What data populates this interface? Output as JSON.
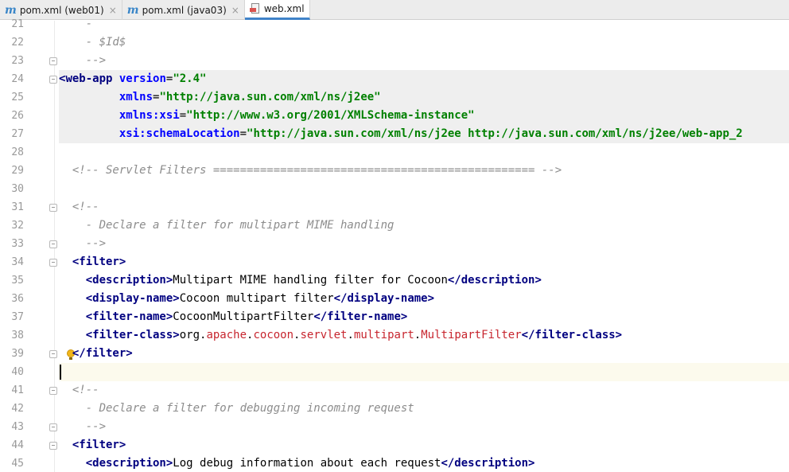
{
  "tabs": [
    {
      "label": "pom.xml (web01)",
      "icon": "maven-icon",
      "active": false
    },
    {
      "label": "pom.xml (java03)",
      "icon": "maven-icon",
      "active": false
    },
    {
      "label": "web.xml",
      "icon": "xml-file-icon",
      "active": true
    }
  ],
  "icons": {
    "maven_glyph": "m",
    "close_glyph": "×"
  },
  "colors": {
    "tag": "#000080",
    "attribute": "#0000ff",
    "value": "#008000",
    "comment": "#8c8c8c",
    "package": "#c7252e",
    "active_tab_underline": "#4083c9"
  },
  "editor": {
    "lines": [
      {
        "num": "21",
        "fold": false,
        "tokens": [
          {
            "t": "    -",
            "c": "c-comment"
          }
        ]
      },
      {
        "num": "22",
        "fold": false,
        "tokens": [
          {
            "t": "    - $Id$",
            "c": "c-comment"
          }
        ]
      },
      {
        "num": "23",
        "fold": true,
        "tokens": [
          {
            "t": "    -->",
            "c": "c-comment"
          }
        ]
      },
      {
        "num": "24",
        "fold": true,
        "hl": true,
        "tokens": [
          {
            "t": "<",
            "c": "c-tag"
          },
          {
            "t": "web-app ",
            "c": "c-tag"
          },
          {
            "t": "version",
            "c": "c-attr"
          },
          {
            "t": "=",
            "c": "c-br"
          },
          {
            "t": "\"2.4\"",
            "c": "c-val"
          }
        ]
      },
      {
        "num": "25",
        "fold": false,
        "hl": true,
        "tokens": [
          {
            "t": "         xmlns",
            "c": "c-attr"
          },
          {
            "t": "=",
            "c": "c-br"
          },
          {
            "t": "\"http://java.sun.com/xml/ns/j2ee\"",
            "c": "c-val"
          }
        ]
      },
      {
        "num": "26",
        "fold": false,
        "hl": true,
        "tokens": [
          {
            "t": "         xmlns:xsi",
            "c": "c-attr"
          },
          {
            "t": "=",
            "c": "c-br"
          },
          {
            "t": "\"http://www.w3.org/2001/XMLSchema-instance\"",
            "c": "c-val"
          }
        ]
      },
      {
        "num": "27",
        "fold": false,
        "hl": true,
        "tokens": [
          {
            "t": "         xsi:schemaLocation",
            "c": "c-attr"
          },
          {
            "t": "=",
            "c": "c-br"
          },
          {
            "t": "\"http://java.sun.com/xml/ns/j2ee http://java.sun.com/xml/ns/j2ee/web-app_2",
            "c": "c-val"
          }
        ]
      },
      {
        "num": "28",
        "fold": false,
        "tokens": []
      },
      {
        "num": "29",
        "fold": false,
        "tokens": [
          {
            "t": "  <!-- Servlet Filters ================================================ -->",
            "c": "c-comment"
          }
        ]
      },
      {
        "num": "30",
        "fold": false,
        "tokens": []
      },
      {
        "num": "31",
        "fold": true,
        "tokens": [
          {
            "t": "  <!--",
            "c": "c-comment"
          }
        ]
      },
      {
        "num": "32",
        "fold": false,
        "tokens": [
          {
            "t": "    - Declare a filter for multipart MIME handling",
            "c": "c-comment"
          }
        ]
      },
      {
        "num": "33",
        "fold": true,
        "tokens": [
          {
            "t": "    -->",
            "c": "c-comment"
          }
        ]
      },
      {
        "num": "34",
        "fold": true,
        "tokens": [
          {
            "t": "  ",
            "c": "c-txt"
          },
          {
            "t": "<filter>",
            "c": "c-tag"
          }
        ]
      },
      {
        "num": "35",
        "fold": false,
        "tokens": [
          {
            "t": "    ",
            "c": "c-txt"
          },
          {
            "t": "<description>",
            "c": "c-tag"
          },
          {
            "t": "Multipart MIME handling filter for Cocoon",
            "c": "c-txt"
          },
          {
            "t": "</description>",
            "c": "c-tag"
          }
        ]
      },
      {
        "num": "36",
        "fold": false,
        "tokens": [
          {
            "t": "    ",
            "c": "c-txt"
          },
          {
            "t": "<display-name>",
            "c": "c-tag"
          },
          {
            "t": "Cocoon multipart filter",
            "c": "c-txt"
          },
          {
            "t": "</display-name>",
            "c": "c-tag"
          }
        ]
      },
      {
        "num": "37",
        "fold": false,
        "tokens": [
          {
            "t": "    ",
            "c": "c-txt"
          },
          {
            "t": "<filter-name>",
            "c": "c-tag"
          },
          {
            "t": "CocoonMultipartFilter",
            "c": "c-txt"
          },
          {
            "t": "</filter-name>",
            "c": "c-tag"
          }
        ]
      },
      {
        "num": "38",
        "fold": false,
        "tokens": [
          {
            "t": "    ",
            "c": "c-txt"
          },
          {
            "t": "<filter-class>",
            "c": "c-tag"
          },
          {
            "t": "org.",
            "c": "c-txt"
          },
          {
            "t": "apache",
            "c": "c-pkg"
          },
          {
            "t": ".",
            "c": "c-txt"
          },
          {
            "t": "cocoon",
            "c": "c-pkg"
          },
          {
            "t": ".",
            "c": "c-txt"
          },
          {
            "t": "servlet",
            "c": "c-pkg"
          },
          {
            "t": ".",
            "c": "c-txt"
          },
          {
            "t": "multipart",
            "c": "c-pkg"
          },
          {
            "t": ".",
            "c": "c-txt"
          },
          {
            "t": "MultipartFilter",
            "c": "c-pkg"
          },
          {
            "t": "</filter-class>",
            "c": "c-tag"
          }
        ]
      },
      {
        "num": "39",
        "fold": true,
        "bulb": true,
        "tokens": [
          {
            "t": "  ",
            "c": "c-txt"
          },
          {
            "t": "</filter>",
            "c": "c-tag"
          }
        ]
      },
      {
        "num": "40",
        "fold": false,
        "cur": true,
        "tokens": []
      },
      {
        "num": "41",
        "fold": true,
        "tokens": [
          {
            "t": "  <!--",
            "c": "c-comment"
          }
        ]
      },
      {
        "num": "42",
        "fold": false,
        "tokens": [
          {
            "t": "    - Declare a filter for debugging incoming request",
            "c": "c-comment"
          }
        ]
      },
      {
        "num": "43",
        "fold": true,
        "tokens": [
          {
            "t": "    -->",
            "c": "c-comment"
          }
        ]
      },
      {
        "num": "44",
        "fold": true,
        "tokens": [
          {
            "t": "  ",
            "c": "c-txt"
          },
          {
            "t": "<filter>",
            "c": "c-tag"
          }
        ]
      },
      {
        "num": "45",
        "fold": false,
        "tokens": [
          {
            "t": "    ",
            "c": "c-txt"
          },
          {
            "t": "<description>",
            "c": "c-tag"
          },
          {
            "t": "Log debug information about each request",
            "c": "c-txt"
          },
          {
            "t": "</description>",
            "c": "c-tag"
          }
        ]
      }
    ]
  }
}
